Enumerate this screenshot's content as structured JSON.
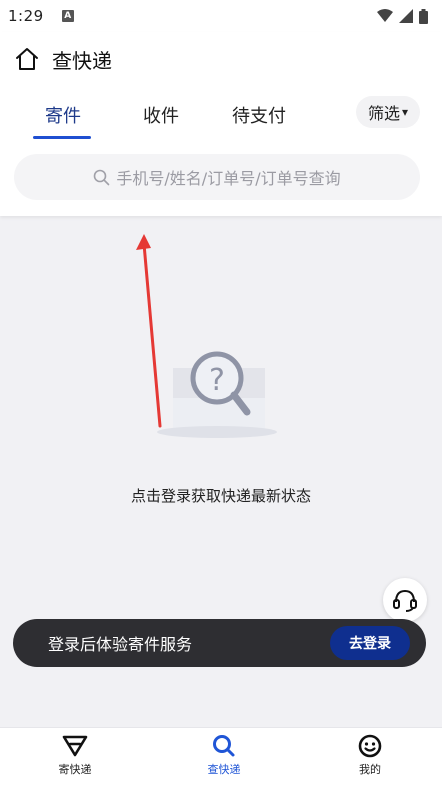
{
  "status_bar": {
    "time": "1:29",
    "indicator": "A"
  },
  "header": {
    "title": "查快递",
    "home_icon": "home-icon"
  },
  "tabs": [
    {
      "label": "寄件",
      "active": true
    },
    {
      "label": "收件",
      "active": false
    },
    {
      "label": "待支付",
      "active": false
    }
  ],
  "filter": {
    "label": "筛选",
    "caret": "▾"
  },
  "search": {
    "placeholder": "手机号/姓名/订单号/订单号查询"
  },
  "empty_state": {
    "message": "点击登录获取快递最新状态"
  },
  "login_banner": {
    "text": "登录后体验寄件服务",
    "button_label": "去登录"
  },
  "bottom_nav": [
    {
      "label": "寄快递",
      "icon": "send-icon",
      "active": false
    },
    {
      "label": "查快递",
      "icon": "search-icon",
      "active": true
    },
    {
      "label": "我的",
      "icon": "smiley-icon",
      "active": false
    }
  ],
  "colors": {
    "accent": "#1f55d6",
    "tab_active": "#1e3a8a",
    "banner_bg": "#2e2e32",
    "login_button": "#0f2f8f",
    "annotation_arrow": "#e53935"
  }
}
